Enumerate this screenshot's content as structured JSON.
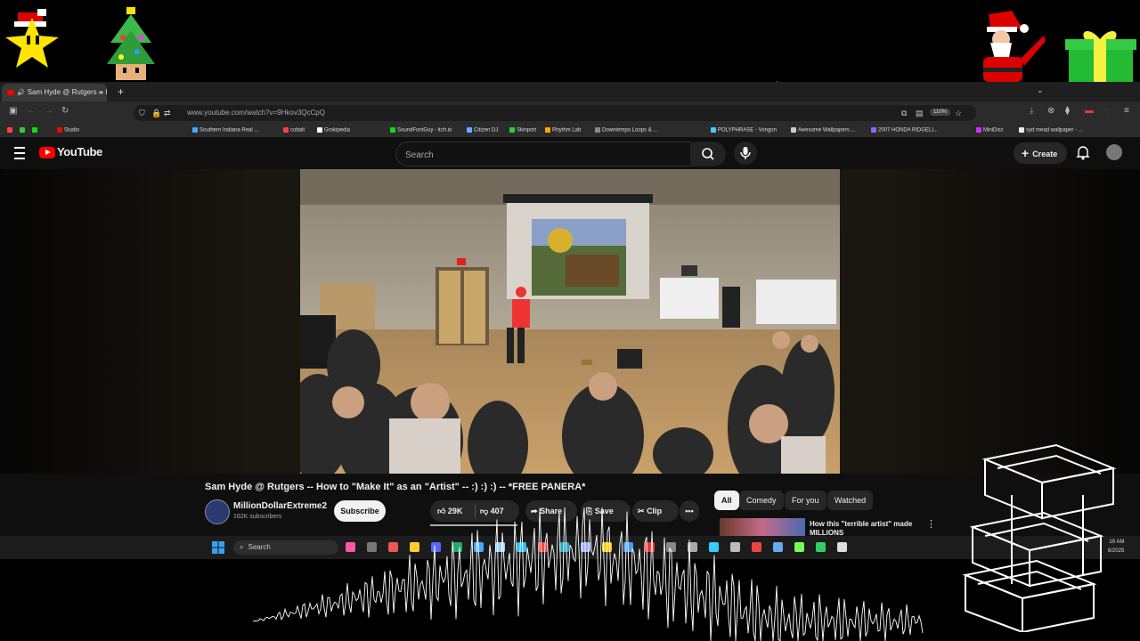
{
  "browser": {
    "tab_title": "Sam Hyde @ Rutgers -- Ho",
    "tab_close": "×",
    "new_tab": "+",
    "address": "www.youtube.com/watch?v=9Hkov3QcCpQ",
    "zoom": "110%",
    "bookmarks": [
      "Studio",
      "Southern Indiana Real ...",
      "cobalt",
      "Grokipedia",
      "SoundFontGuy - itch.io",
      "Citizen DJ",
      "Skinport",
      "Rhythm Lab",
      "Downtempo Loops & ...",
      "POLYPHRASE - Vongon",
      "Awesome Wallpapers ...",
      "2007 HONDA RIDGELI...",
      "MiniDisc",
      "syd mead wallpaper - ..."
    ]
  },
  "youtube": {
    "logo_text": "YouTube",
    "search_placeholder": "Search",
    "create_label": "Create"
  },
  "video": {
    "title": "Sam Hyde @ Rutgers -- How to \"Make It\" as an \"Artist\" -- :) :) :) -- *FREE PANERA*",
    "channel": "MillionDollarExtreme2",
    "subscribers": "162K subscribers",
    "subscribe_label": "Subscribe",
    "likes": "29K",
    "dislikes": "407",
    "share_label": "Share",
    "save_label": "Save",
    "clip_label": "Clip",
    "more_label": "•••"
  },
  "sidebar": {
    "chips": [
      "All",
      "Comedy",
      "For you",
      "Watched"
    ],
    "rec_title": "How this \"terrible artist\" made MILLIONS",
    "rec_menu": "⋮"
  },
  "taskbar": {
    "search_label": "Search",
    "time": "19 AM",
    "date": "6/2025"
  },
  "colors": {
    "youtube_red": "#ff0000",
    "background": "#0f0f0f",
    "chip_active": "#f1f1f1"
  }
}
